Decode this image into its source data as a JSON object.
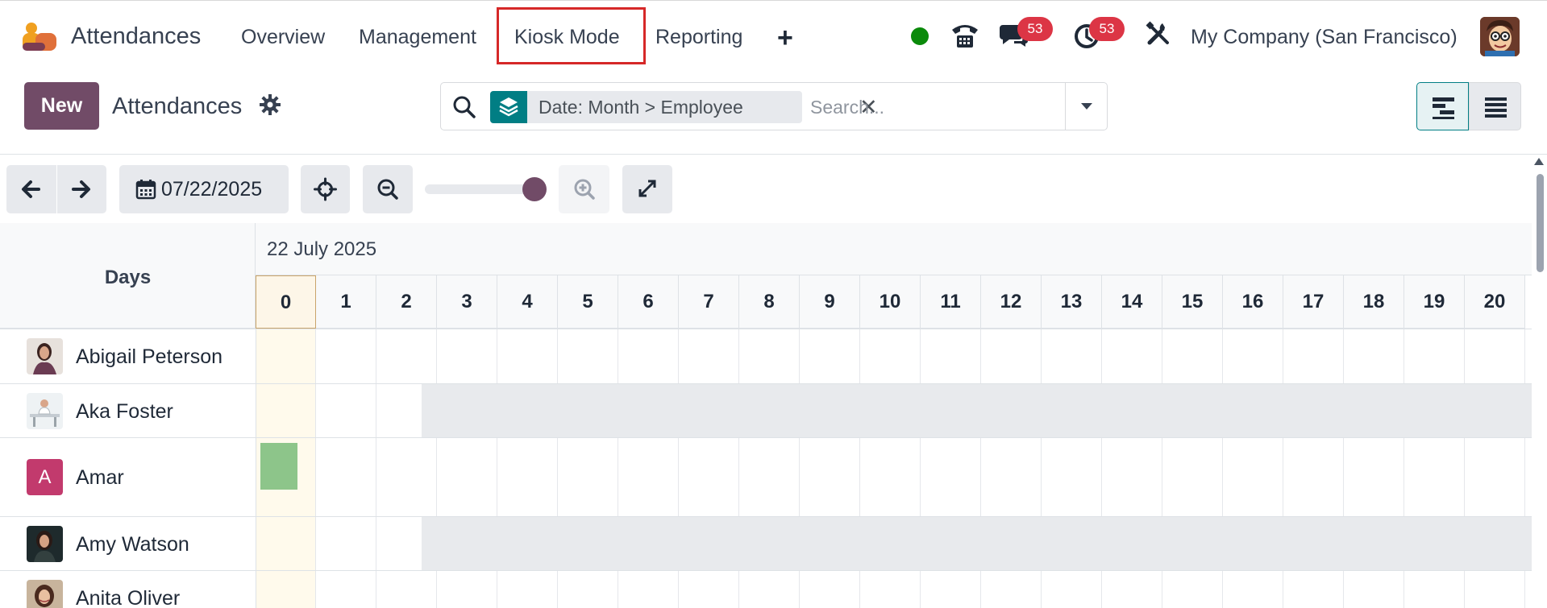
{
  "navbar": {
    "app_name": "Attendances",
    "menu": [
      "Overview",
      "Management",
      "Kiosk Mode",
      "Reporting"
    ],
    "plus_label": "+",
    "messages_count": "53",
    "activities_count": "53",
    "company": "My Company (San Francisco)"
  },
  "control_panel": {
    "new_label": "New",
    "title": "Attendances",
    "facet_label": "Date: Month > Employee",
    "facet_remove": "✕",
    "search_placeholder": "Search..."
  },
  "gantt": {
    "current_date": "07/22/2025",
    "scale_level": 1.0,
    "header_left": "Days",
    "header_date": "22 July 2025",
    "hours": [
      "0",
      "1",
      "2",
      "3",
      "4",
      "5",
      "6",
      "7",
      "8",
      "9",
      "10",
      "11",
      "12",
      "13",
      "14",
      "15",
      "16",
      "17",
      "18",
      "19",
      "20"
    ],
    "rows": [
      {
        "name": "Abigail Peterson",
        "avatar": "photo-woman-dark-hair"
      },
      {
        "name": "Aka Foster",
        "avatar": "photo-woman-desk"
      },
      {
        "name": "Amar",
        "avatar_letter": "A"
      },
      {
        "name": "Amy Watson",
        "avatar": "photo-woman-dark-bg"
      },
      {
        "name": "Anita Oliver",
        "avatar": "photo-woman-smiling"
      }
    ]
  },
  "colors": {
    "brand": "#714b67",
    "teal": "#017e84",
    "badge": "#dc3545",
    "status_online": "#0a8a0a",
    "attendance_bar": "#8dc58a",
    "highlight_box": "#d62828"
  }
}
